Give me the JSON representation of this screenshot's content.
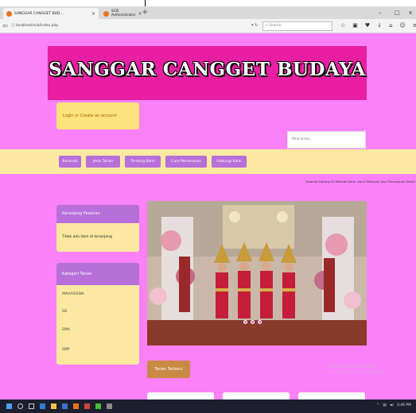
{
  "browser": {
    "tabs": [
      {
        "label": "SANGGAR CANGGET BUD…",
        "active": true
      },
      {
        "label": "SCB Administrator",
        "active": false
      }
    ],
    "new_tab": "+",
    "window_controls": [
      "–",
      "□",
      "x"
    ],
    "url": "localhost/scb/index.php",
    "search_placeholder": "Search"
  },
  "site": {
    "title": "SANGGAR CANGGET BUDAYA",
    "login": {
      "login_label": "Login",
      "or_label": "or",
      "create_label": "Create an account"
    },
    "search_placeholder": "Pencarian..",
    "nav": [
      "Beranda",
      "Jenis Tarian",
      "Tentang Kami",
      "Cara Pemesanan",
      "Hubungi Kami"
    ],
    "marquee": "Selamat Datang Di Website Kami. Kami Melayani Jasa Pemesanan Tarian",
    "cart": {
      "title": "Keranjang Pesanan",
      "empty": "Tidak ada item di keranjang"
    },
    "categories": {
      "title": "Kategori Tarian",
      "items": [
        "MAHASISWA",
        "SD",
        "SMA",
        "SMP"
      ]
    },
    "slides_count": 3,
    "latest_button": "Tarian Terbaru"
  },
  "os": {
    "activate_title": "Activate Windows",
    "activate_sub": "Go to Settings to activate Windows.",
    "clock": "3:46 PM"
  },
  "colors": {
    "page_bg": "#fa81fa",
    "banner_bg": "#e81fa2",
    "nav_bg": "#fbe9a1",
    "nav_item": "#b76fd9",
    "panel_body": "#fbe9a1",
    "latest_button": "#c98a45"
  }
}
